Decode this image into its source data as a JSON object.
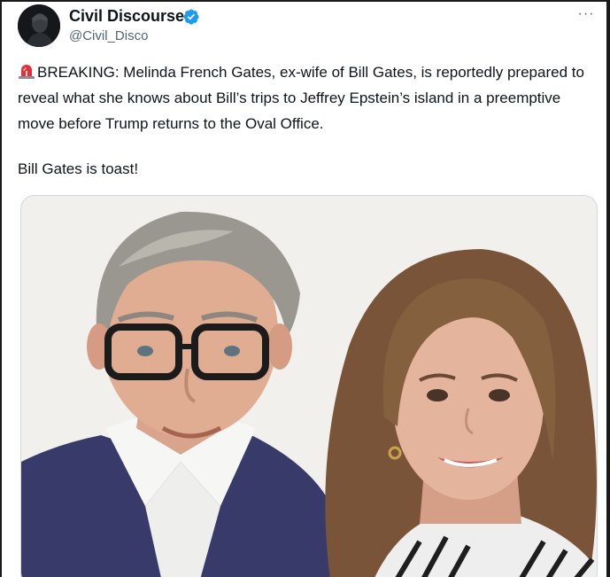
{
  "tweet": {
    "author": {
      "name": "Civil Discourse",
      "handle": "@Civil_Disco",
      "avatar_icon": "avatar-silhouette",
      "verified": true,
      "verified_color": "#1d9bf0"
    },
    "more_label": "···",
    "text_lead_icon": "siren-emoji",
    "text": "BREAKING: Melinda French Gates, ex-wife of Bill Gates, is reportedly prepared to reveal what she knows about Bill’s trips to Jeffrey Epstein’s island in a preemptive move before Trump returns to the Oval Office.",
    "text2": "Bill Gates is toast!",
    "media": {
      "type": "photo"
    }
  },
  "colors": {
    "text": "#0f1419",
    "secondary": "#536471",
    "accent": "#1d9bf0"
  }
}
